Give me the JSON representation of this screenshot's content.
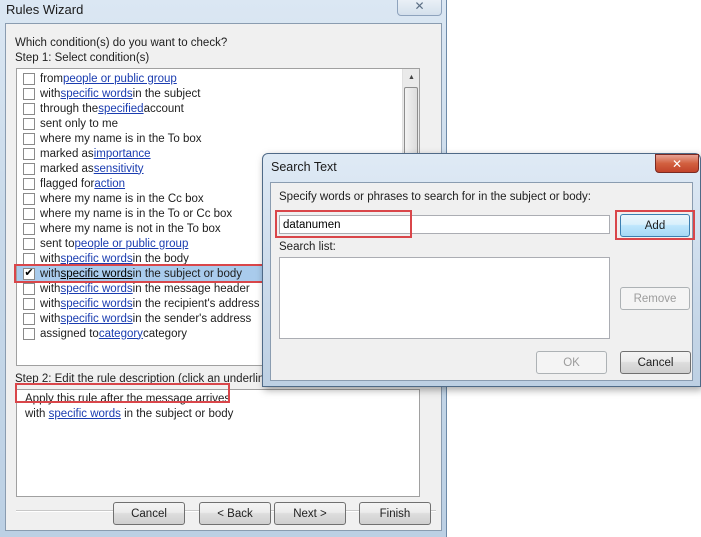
{
  "rules_wizard": {
    "title": "Rules Wizard",
    "close_icon": "close-icon",
    "question": "Which condition(s) do you want to check?",
    "step1_label": "Step 1: Select condition(s)",
    "conditions": [
      {
        "pre": "from ",
        "link": "people or public group",
        "post": "",
        "checked": false
      },
      {
        "pre": "with ",
        "link": "specific words",
        "post": " in the subject",
        "checked": false
      },
      {
        "pre": "through the ",
        "link": "specified",
        "post": " account",
        "checked": false
      },
      {
        "pre": "sent only to me",
        "link": "",
        "post": "",
        "checked": false
      },
      {
        "pre": "where my name is in the To box",
        "link": "",
        "post": "",
        "checked": false
      },
      {
        "pre": "marked as ",
        "link": "importance",
        "post": "",
        "checked": false
      },
      {
        "pre": "marked as ",
        "link": "sensitivity",
        "post": "",
        "checked": false
      },
      {
        "pre": "flagged for ",
        "link": "action",
        "post": "",
        "checked": false
      },
      {
        "pre": "where my name is in the Cc box",
        "link": "",
        "post": "",
        "checked": false
      },
      {
        "pre": "where my name is in the To or Cc box",
        "link": "",
        "post": "",
        "checked": false
      },
      {
        "pre": "where my name is not in the To box",
        "link": "",
        "post": "",
        "checked": false
      },
      {
        "pre": "sent to ",
        "link": "people or public group",
        "post": "",
        "checked": false
      },
      {
        "pre": "with ",
        "link": "specific words",
        "post": " in the body",
        "checked": false
      },
      {
        "pre": "with ",
        "link": "specific words",
        "post": " in the subject or body",
        "checked": true
      },
      {
        "pre": "with ",
        "link": "specific words",
        "post": " in the message header",
        "checked": false
      },
      {
        "pre": "with ",
        "link": "specific words",
        "post": " in the recipient's address",
        "checked": false
      },
      {
        "pre": "with ",
        "link": "specific words",
        "post": " in the sender's address",
        "checked": false
      },
      {
        "pre": "assigned to ",
        "link": "category",
        "post": " category",
        "checked": false
      }
    ],
    "step2_label": "Step 2: Edit the rule description (click an underlined",
    "description": {
      "line1": "Apply this rule after the message arrives",
      "line2_pre": "with ",
      "line2_link": "specific words",
      "line2_post": " in the subject or body"
    },
    "buttons": {
      "cancel": "Cancel",
      "back": "< Back",
      "next": "Next >",
      "finish": "Finish"
    }
  },
  "search_text": {
    "title": "Search Text",
    "close_icon": "close-icon",
    "prompt": "Specify words or phrases to search for in the subject or body:",
    "input_value": "datanumen",
    "add_label": "Add",
    "search_list_label": "Search list:",
    "search_list_items": [],
    "remove_label": "Remove",
    "ok_label": "OK",
    "cancel_label": "Cancel"
  },
  "colors": {
    "highlight_box": "#d9464a",
    "link": "#1a3cb0",
    "selection": "#a9cbec"
  }
}
